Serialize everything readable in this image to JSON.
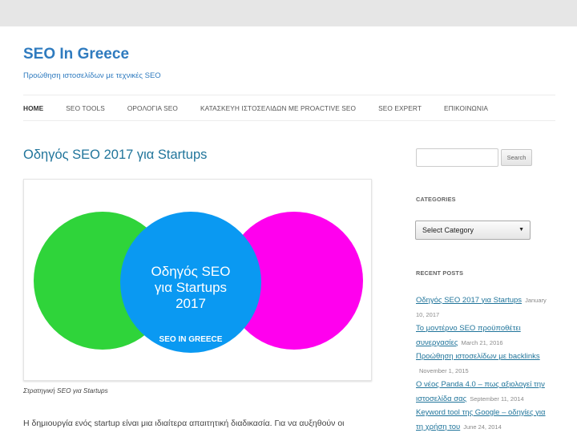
{
  "site": {
    "title": "SEO In Greece",
    "description": "Προώθηση ιστοσελίδων με τεχνικές SEO"
  },
  "nav": {
    "items": [
      {
        "label": "HOME"
      },
      {
        "label": "SEO TOOLS"
      },
      {
        "label": "ΟΡΟΛΟΓΙΑ SEO"
      },
      {
        "label": "ΚΑΤΑΣΚΕΥΗ ΙΣΤΟΣΕΛΙΔΩΝ ΜΕ PROACTIVE SEO"
      },
      {
        "label": "SEO EXPERT"
      },
      {
        "label": "ΕΠΙΚΟΙΝΩΝΙΑ"
      }
    ]
  },
  "post": {
    "title": "Οδηγός SEO 2017 για Startups",
    "image": {
      "line1": "Οδηγός SEO",
      "line2": "για Startups",
      "line3": "2017",
      "logo": "SEO IN GREECE",
      "colors": {
        "left": "#2fd43a",
        "middle": "#0a99f2",
        "right": "#ff00ee"
      }
    },
    "caption": "Στρατηγική SEO για Startups",
    "paragraph": "Η δημιουργία ενός startup είναι μια ιδιαίτερα απαιτητική διαδικασία. Για να αυξηθούν οι"
  },
  "sidebar": {
    "search_button": "Search",
    "categories_title": "CATEGORIES",
    "select_category": "Select Category",
    "recent_title": "RECENT POSTS",
    "recent_posts": [
      {
        "title": "Οδηγός SEO 2017 για Startups",
        "date_a": "January",
        "date_b": "10, 2017"
      },
      {
        "title_a": "Το μοντέρνο SEO προϋποθέτει",
        "title_b": "συνεργασίες",
        "date": "March 21, 2016"
      },
      {
        "title": "Προώθηση ιστοσελίδων με backlinks",
        "date": "November 1, 2015"
      },
      {
        "title_a": "Ο νέος Panda 4.0 – πως αξιολογεί την",
        "title_b": "ιστοσελίδα σας",
        "date": "September 11, 2014"
      },
      {
        "title_a": "Keyword tool της Google – οδηγίες για",
        "title_b": "τη χρήση του",
        "date": "June 24, 2014"
      }
    ]
  }
}
